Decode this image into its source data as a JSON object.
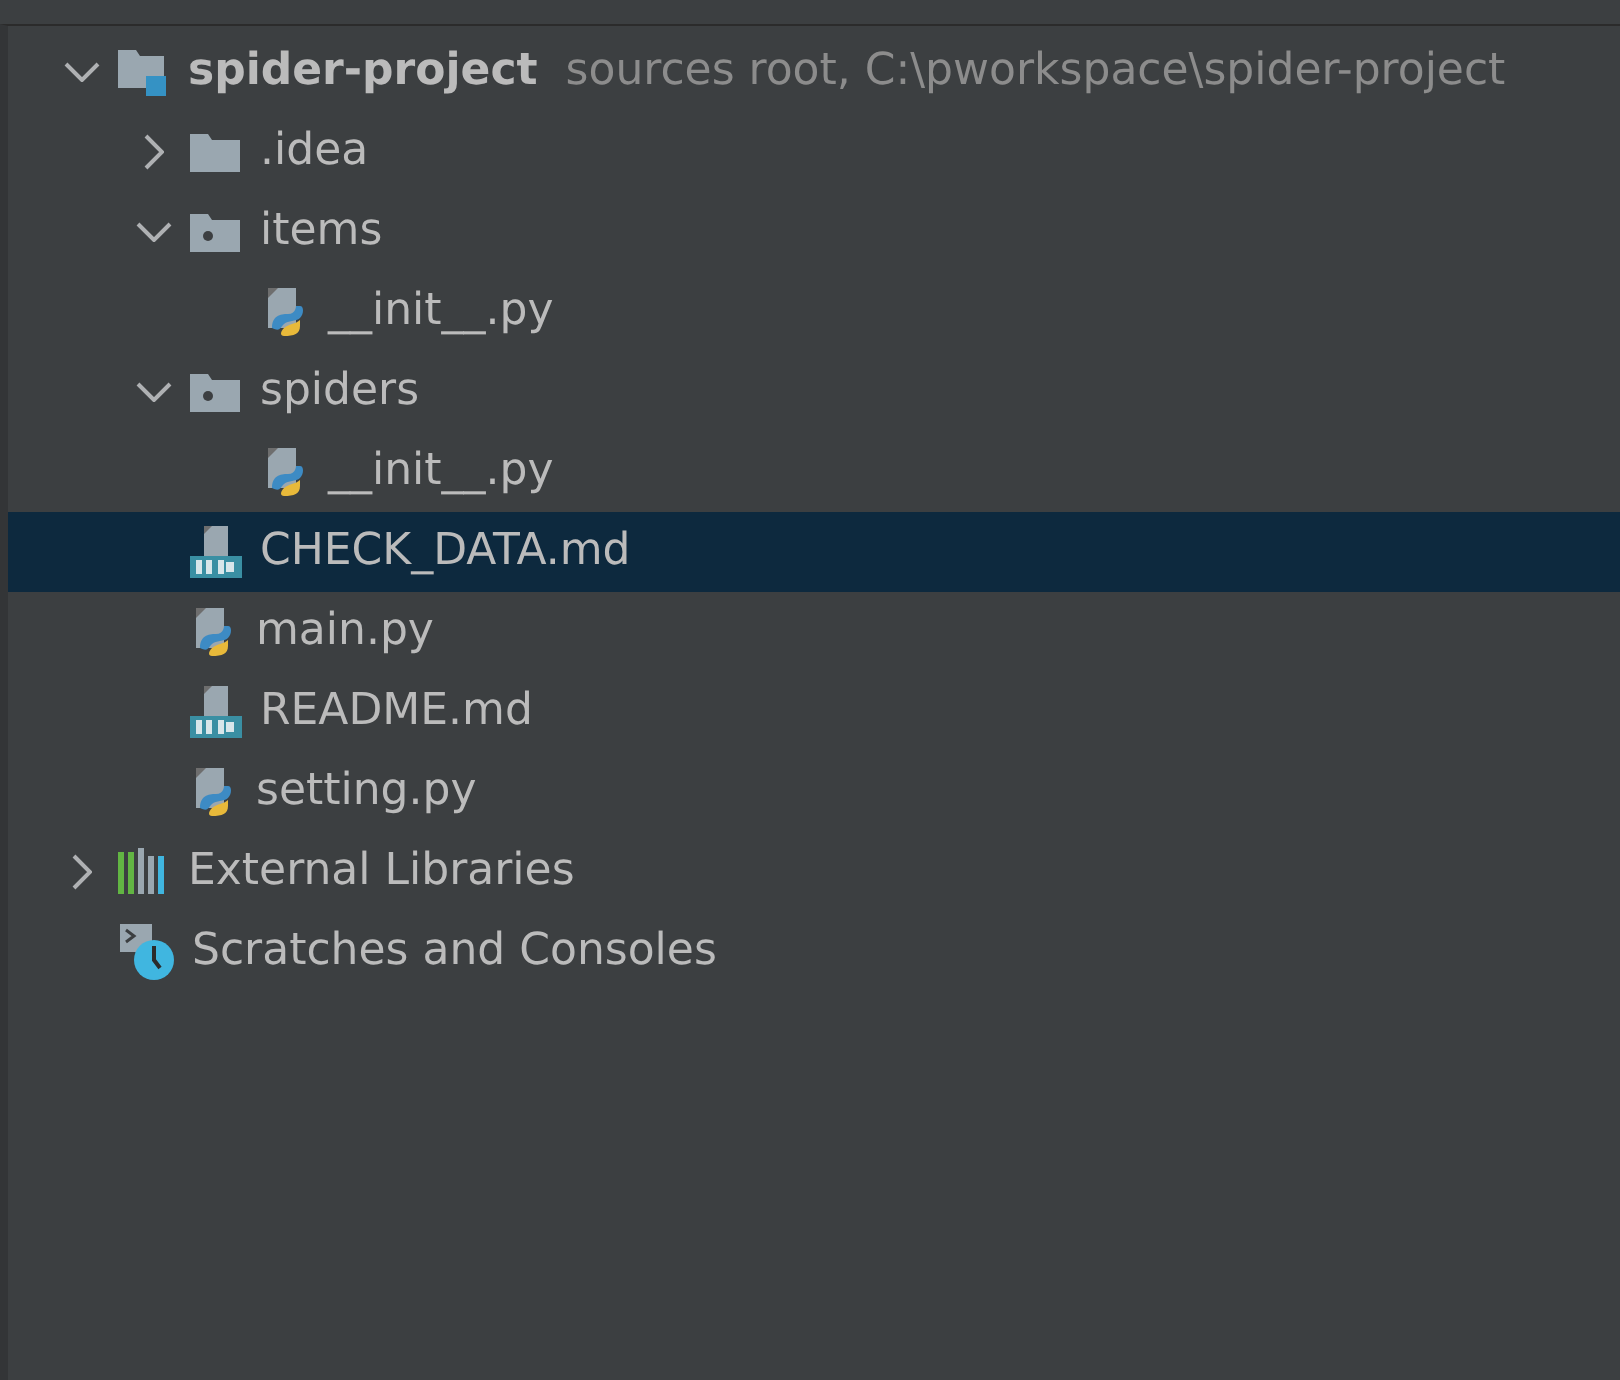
{
  "project_tree": [
    {
      "kind": "project",
      "label": "spider-project",
      "hint": "sources root,  C:\\pworkspace\\spider-project",
      "expanded": true,
      "selected": false,
      "children": [
        {
          "kind": "folder",
          "label": ".idea",
          "expanded": false,
          "selected": false
        },
        {
          "kind": "package",
          "label": "items",
          "expanded": true,
          "selected": false,
          "children": [
            {
              "kind": "python",
              "label": "__init__.py",
              "selected": false
            }
          ]
        },
        {
          "kind": "package",
          "label": "spiders",
          "expanded": true,
          "selected": false,
          "children": [
            {
              "kind": "python",
              "label": "__init__.py",
              "selected": false
            }
          ]
        },
        {
          "kind": "markdown",
          "label": "CHECK_DATA.md",
          "selected": true
        },
        {
          "kind": "python",
          "label": "main.py",
          "selected": false
        },
        {
          "kind": "markdown",
          "label": "README.md",
          "selected": false
        },
        {
          "kind": "python",
          "label": "setting.py",
          "selected": false
        }
      ]
    },
    {
      "kind": "libraries",
      "label": "External Libraries",
      "expanded": false,
      "selected": false
    },
    {
      "kind": "scratches",
      "label": "Scratches and Consoles",
      "selected": false
    }
  ]
}
